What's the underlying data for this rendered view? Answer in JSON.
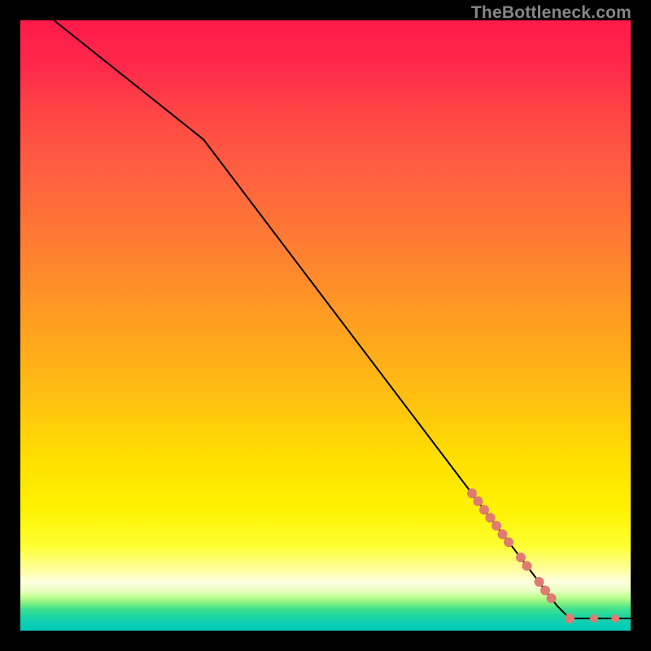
{
  "watermark": "TheBottleneck.com",
  "colors": {
    "dot_fill": "#e07b72",
    "line_stroke": "#000000"
  },
  "chart_data": {
    "type": "line",
    "title": "",
    "xlabel": "",
    "ylabel": "",
    "xlim": [
      0,
      100
    ],
    "ylim": [
      0,
      100
    ],
    "line_series": {
      "name": "curve",
      "points": [
        {
          "x": 5.5,
          "y": 100.0
        },
        {
          "x": 30.0,
          "y": 80.5
        },
        {
          "x": 88.0,
          "y": 4.0
        },
        {
          "x": 90.0,
          "y": 2.0
        },
        {
          "x": 100.0,
          "y": 2.0
        }
      ]
    },
    "dot_series": {
      "name": "highlighted-points",
      "points": [
        {
          "x": 74.0,
          "y": 22.5,
          "r": 6
        },
        {
          "x": 75.0,
          "y": 21.2,
          "r": 6
        },
        {
          "x": 76.0,
          "y": 19.8,
          "r": 6
        },
        {
          "x": 77.0,
          "y": 18.5,
          "r": 6
        },
        {
          "x": 78.0,
          "y": 17.2,
          "r": 6
        },
        {
          "x": 79.0,
          "y": 15.8,
          "r": 6
        },
        {
          "x": 80.0,
          "y": 14.5,
          "r": 6
        },
        {
          "x": 82.0,
          "y": 12.0,
          "r": 6
        },
        {
          "x": 83.0,
          "y": 10.6,
          "r": 6
        },
        {
          "x": 85.0,
          "y": 8.0,
          "r": 6
        },
        {
          "x": 86.0,
          "y": 6.6,
          "r": 6
        },
        {
          "x": 87.0,
          "y": 5.3,
          "r": 6
        },
        {
          "x": 90.0,
          "y": 2.0,
          "r": 6
        },
        {
          "x": 94.0,
          "y": 2.0,
          "r": 5
        },
        {
          "x": 97.5,
          "y": 2.0,
          "r": 5
        }
      ]
    }
  }
}
